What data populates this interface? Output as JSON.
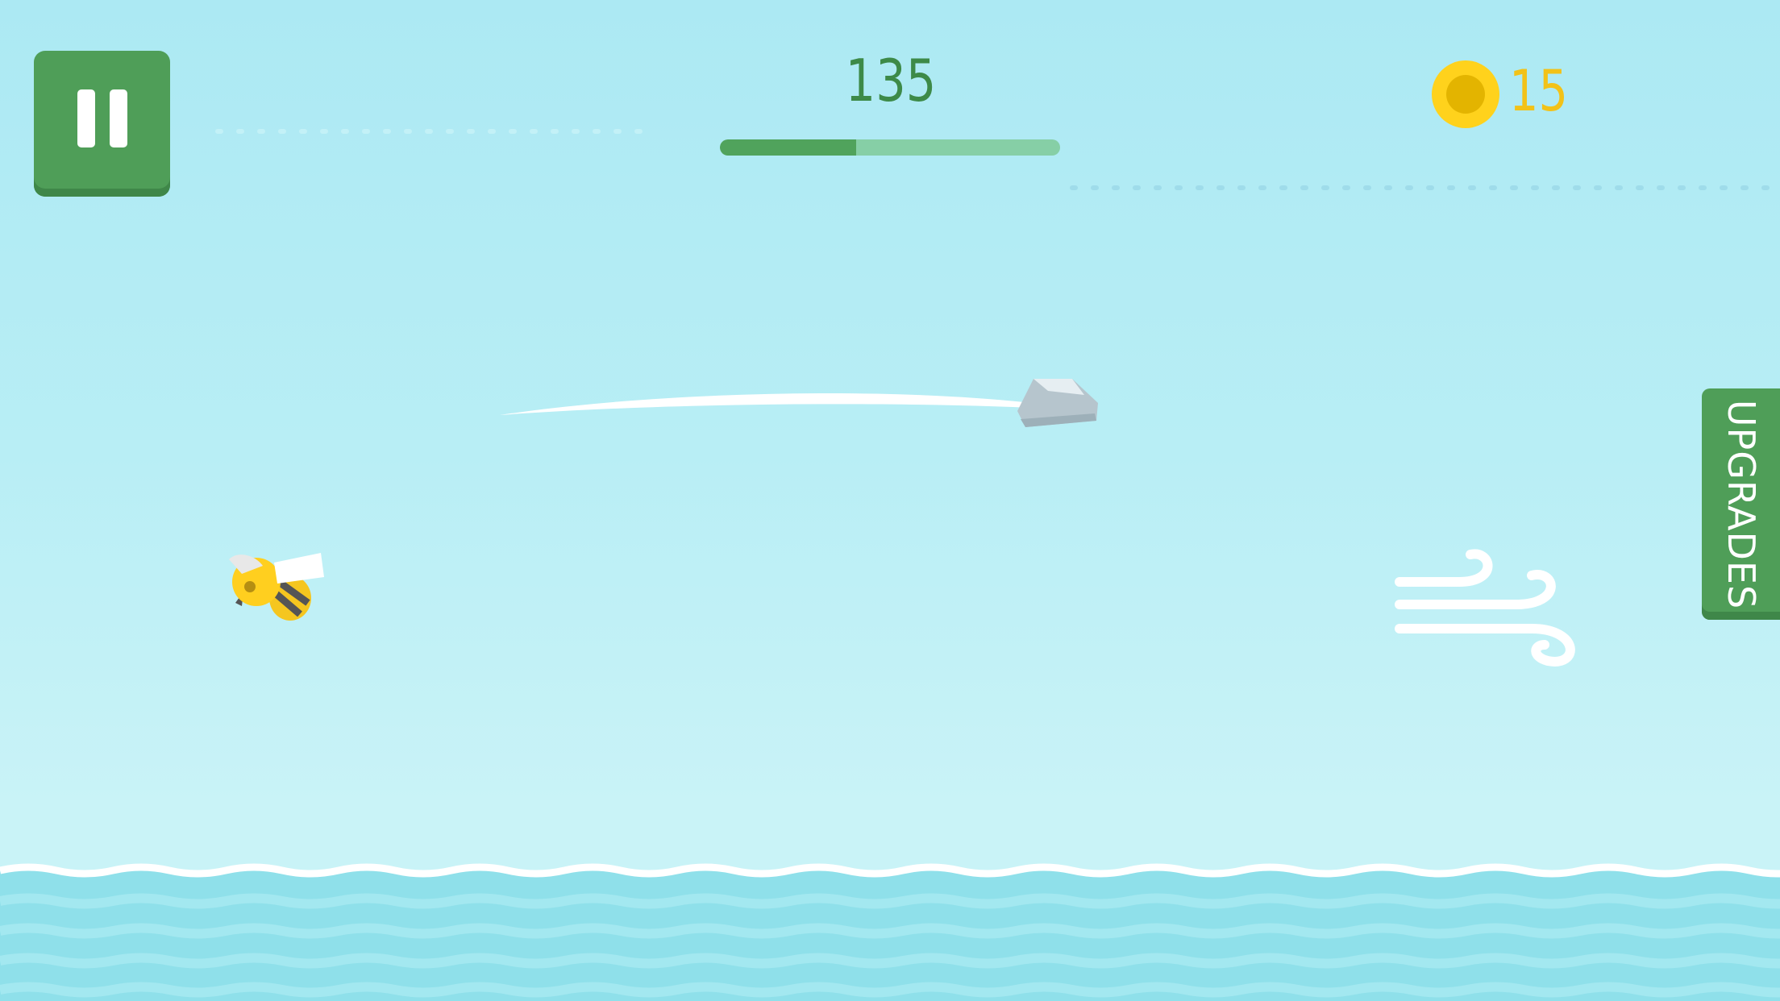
{
  "hud": {
    "distance": "135",
    "progress_fraction": 0.4,
    "coins": "15"
  },
  "side_tab": {
    "label": "UPGRADES"
  },
  "icons": {
    "pause": "pause-icon",
    "coin": "coin-icon",
    "wind": "wind-icon"
  },
  "colors": {
    "accent_green": "#4f9e58",
    "coin_yellow": "#ffd21c",
    "sky": "#b8eef5",
    "water": "#8fe0ea"
  }
}
